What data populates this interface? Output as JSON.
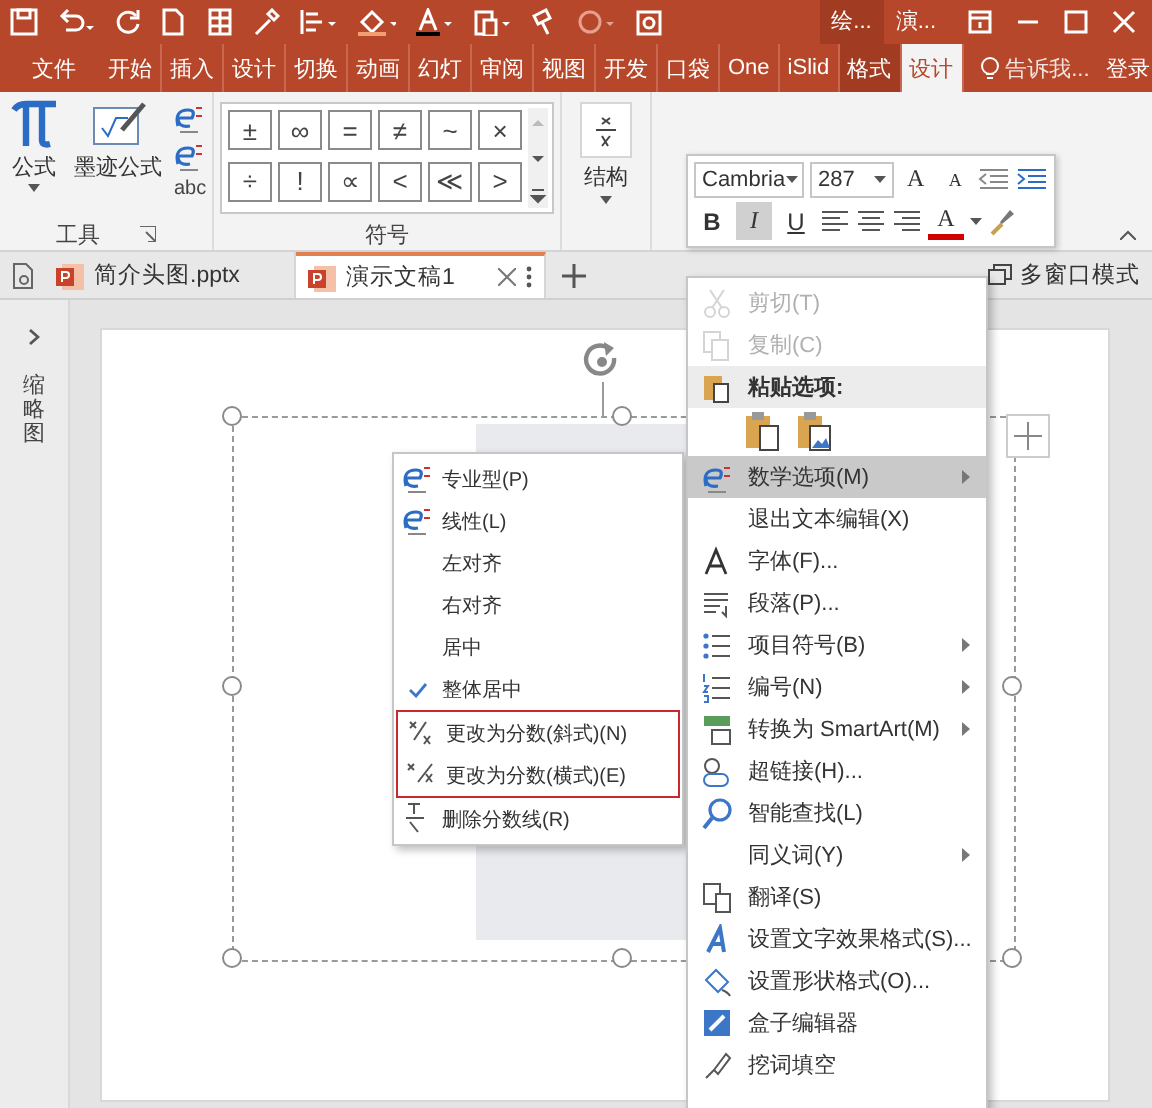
{
  "title_bar": {
    "context_tabs": [
      "绘...",
      "演..."
    ]
  },
  "ribbon_tabs": [
    {
      "label": "文件",
      "kind": "file",
      "selected": false
    },
    {
      "label": "开始",
      "kind": "tab",
      "selected": false
    },
    {
      "label": "插入",
      "kind": "tab",
      "selected": false
    },
    {
      "label": "设计",
      "kind": "tab",
      "selected": false
    },
    {
      "label": "切换",
      "kind": "tab",
      "selected": false
    },
    {
      "label": "动画",
      "kind": "tab",
      "selected": false
    },
    {
      "label": "幻灯",
      "kind": "tab",
      "selected": false
    },
    {
      "label": "审阅",
      "kind": "tab",
      "selected": false
    },
    {
      "label": "视图",
      "kind": "tab",
      "selected": false
    },
    {
      "label": "开发",
      "kind": "tab",
      "selected": false
    },
    {
      "label": "口袋",
      "kind": "tab",
      "selected": false
    },
    {
      "label": "One",
      "kind": "tab",
      "selected": false
    },
    {
      "label": "iSlid",
      "kind": "tab",
      "selected": false
    },
    {
      "label": "格式",
      "kind": "context",
      "selected": false
    },
    {
      "label": "设计",
      "kind": "context",
      "selected": true
    },
    {
      "label": "告诉我...",
      "kind": "tell",
      "selected": false
    },
    {
      "label": "登录",
      "kind": "login",
      "selected": false
    }
  ],
  "ribbon": {
    "tools": {
      "formula": "公式",
      "ink": "墨迹公式",
      "abc": "abc",
      "label": "工具"
    },
    "symbols": {
      "items": [
        "±",
        "∞",
        "=",
        "≠",
        "~",
        "×",
        "÷",
        "!",
        "∝",
        "<",
        "≪",
        ">"
      ],
      "label": "符号"
    },
    "structure": {
      "label": "结构"
    }
  },
  "mini_toolbar": {
    "font": "Cambria",
    "size": "287",
    "grow": "A",
    "shrink": "A",
    "styles": [
      {
        "label": "B",
        "selected": false
      },
      {
        "label": "I",
        "selected": true
      },
      {
        "label": "U",
        "selected": false
      }
    ],
    "font_color": "A"
  },
  "doc_tabs": [
    {
      "label": "简介头图.pptx",
      "selected": false
    },
    {
      "label": "演示文稿1",
      "selected": true
    }
  ],
  "window_mode": "多窗口模式",
  "side_panel": {
    "label": "缩略图"
  },
  "math_submenu": [
    {
      "label": "专业型(P)",
      "checked": false,
      "outlined": false
    },
    {
      "label": "线性(L)",
      "checked": false,
      "outlined": false
    },
    {
      "label": "左对齐",
      "checked": false,
      "outlined": false
    },
    {
      "label": "右对齐",
      "checked": false,
      "outlined": false
    },
    {
      "label": "居中",
      "checked": false,
      "outlined": false
    },
    {
      "label": "整体居中",
      "checked": true,
      "outlined": false
    },
    {
      "label": "更改为分数(斜式)(N)",
      "checked": false,
      "outlined": true
    },
    {
      "label": "更改为分数(横式)(E)",
      "checked": false,
      "outlined": true
    },
    {
      "label": "删除分数线(R)",
      "checked": false,
      "outlined": false
    }
  ],
  "context_menu": [
    {
      "kind": "item",
      "label": "剪切(T)",
      "disabled": true,
      "selected": false,
      "submenu": false
    },
    {
      "kind": "item",
      "label": "复制(C)",
      "disabled": true,
      "selected": false,
      "submenu": false
    },
    {
      "kind": "header",
      "label": "粘贴选项:"
    },
    {
      "kind": "paste"
    },
    {
      "kind": "item",
      "label": "数学选项(M)",
      "disabled": false,
      "selected": true,
      "submenu": true
    },
    {
      "kind": "item",
      "label": "退出文本编辑(X)",
      "disabled": false,
      "selected": false,
      "submenu": false
    },
    {
      "kind": "item",
      "label": "字体(F)...",
      "disabled": false,
      "selected": false,
      "submenu": false
    },
    {
      "kind": "item",
      "label": "段落(P)...",
      "disabled": false,
      "selected": false,
      "submenu": false
    },
    {
      "kind": "item",
      "label": "项目符号(B)",
      "disabled": false,
      "selected": false,
      "submenu": true
    },
    {
      "kind": "item",
      "label": "编号(N)",
      "disabled": false,
      "selected": false,
      "submenu": true
    },
    {
      "kind": "item",
      "label": "转换为 SmartArt(M)",
      "disabled": false,
      "selected": false,
      "submenu": true
    },
    {
      "kind": "item",
      "label": "超链接(H)...",
      "disabled": false,
      "selected": false,
      "submenu": false
    },
    {
      "kind": "item",
      "label": "智能查找(L)",
      "disabled": false,
      "selected": false,
      "submenu": false
    },
    {
      "kind": "item",
      "label": "同义词(Y)",
      "disabled": false,
      "selected": false,
      "submenu": true
    },
    {
      "kind": "item",
      "label": "翻译(S)",
      "disabled": false,
      "selected": false,
      "submenu": false
    },
    {
      "kind": "item",
      "label": "设置文字效果格式(S)...",
      "disabled": false,
      "selected": false,
      "submenu": false
    },
    {
      "kind": "item",
      "label": "设置形状格式(O)...",
      "disabled": false,
      "selected": false,
      "submenu": false
    },
    {
      "kind": "item",
      "label": "盒子编辑器",
      "disabled": false,
      "selected": false,
      "submenu": false
    },
    {
      "kind": "item",
      "label": "挖词填空",
      "disabled": false,
      "selected": false,
      "submenu": false
    }
  ]
}
